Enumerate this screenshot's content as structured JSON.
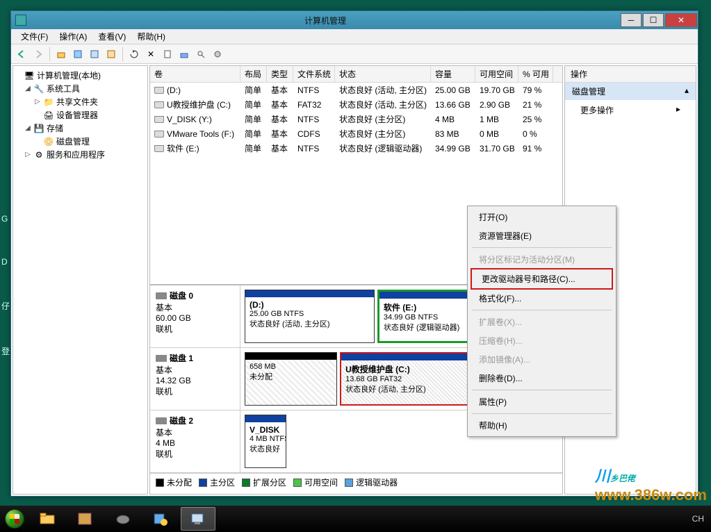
{
  "titlebar": {
    "title": "计算机管理"
  },
  "menubar": {
    "file": "文件(F)",
    "action": "操作(A)",
    "view": "查看(V)",
    "help": "帮助(H)"
  },
  "tree": {
    "root": "计算机管理(本地)",
    "sys_tools": "系统工具",
    "shared_folders": "共享文件夹",
    "device_mgr": "设备管理器",
    "storage": "存储",
    "disk_mgmt": "磁盘管理",
    "services": "服务和应用程序"
  },
  "columns": {
    "vol": "卷",
    "layout": "布局",
    "type": "类型",
    "fs": "文件系统",
    "status": "状态",
    "cap": "容量",
    "free": "可用空间",
    "pct": "% 可用"
  },
  "volumes": [
    {
      "name": "(D:)",
      "layout": "简单",
      "type": "基本",
      "fs": "NTFS",
      "status": "状态良好 (活动, 主分区)",
      "cap": "25.00 GB",
      "free": "19.70 GB",
      "pct": "79 %"
    },
    {
      "name": "U教授维护盘 (C:)",
      "layout": "简单",
      "type": "基本",
      "fs": "FAT32",
      "status": "状态良好 (活动, 主分区)",
      "cap": "13.66 GB",
      "free": "2.90 GB",
      "pct": "21 %"
    },
    {
      "name": "V_DISK (Y:)",
      "layout": "简单",
      "type": "基本",
      "fs": "NTFS",
      "status": "状态良好 (主分区)",
      "cap": "4 MB",
      "free": "1 MB",
      "pct": "25 %"
    },
    {
      "name": "VMware Tools (F:)",
      "layout": "简单",
      "type": "基本",
      "fs": "CDFS",
      "status": "状态良好 (主分区)",
      "cap": "83 MB",
      "free": "0 MB",
      "pct": "0 %"
    },
    {
      "name": "软件 (E:)",
      "layout": "简单",
      "type": "基本",
      "fs": "NTFS",
      "status": "状态良好 (逻辑驱动器)",
      "cap": "34.99 GB",
      "free": "31.70 GB",
      "pct": "91 %"
    }
  ],
  "disks": [
    {
      "name": "磁盘 0",
      "type": "基本",
      "size": "60.00 GB",
      "state": "联机",
      "parts": [
        {
          "label": "(D:)",
          "meta1": "25.00 GB NTFS",
          "meta2": "状态良好 (活动, 主分区)",
          "flex": 25,
          "cls": "part-primary"
        },
        {
          "label": "软件  (E:)",
          "meta1": "34.99 GB NTFS",
          "meta2": "状态良好 (逻辑驱动器)",
          "flex": 35,
          "cls": "part-primary part-green"
        }
      ]
    },
    {
      "name": "磁盘 1",
      "type": "基本",
      "size": "14.32 GB",
      "state": "联机",
      "parts": [
        {
          "label": "",
          "meta1": "658 MB",
          "meta2": "未分配",
          "flex": 12,
          "cls": "part-unalloc"
        },
        {
          "label": "U教授维护盘   (C:)",
          "meta1": "13.68 GB FAT32",
          "meta2": "状态良好 (活动, 主分区)",
          "flex": 30,
          "cls": "part-primary part-selected"
        }
      ]
    },
    {
      "name": "磁盘 2",
      "type": "基本",
      "size": "4 MB",
      "state": "联机",
      "parts": [
        {
          "label": "V_DISK",
          "meta1": "4 MB NTFS",
          "meta2": "状态良好",
          "flex": 6,
          "cls": "part-primary",
          "narrow": true
        }
      ]
    }
  ],
  "legend": {
    "unalloc": "未分配",
    "primary": "主分区",
    "extended": "扩展分区",
    "free": "可用空间",
    "logical": "逻辑驱动器"
  },
  "actions": {
    "header": "操作",
    "disk_mgmt": "磁盘管理",
    "more": "更多操作"
  },
  "context_menu": [
    {
      "label": "打开(O)",
      "enabled": true
    },
    {
      "label": "资源管理器(E)",
      "enabled": true
    },
    {
      "sep": true
    },
    {
      "label": "将分区标记为活动分区(M)",
      "enabled": false
    },
    {
      "label": "更改驱动器号和路径(C)...",
      "enabled": true,
      "highlight": true
    },
    {
      "label": "格式化(F)...",
      "enabled": true
    },
    {
      "sep": true
    },
    {
      "label": "扩展卷(X)...",
      "enabled": false
    },
    {
      "label": "压缩卷(H)...",
      "enabled": false
    },
    {
      "label": "添加镜像(A)...",
      "enabled": false
    },
    {
      "label": "删除卷(D)...",
      "enabled": true
    },
    {
      "sep": true
    },
    {
      "label": "属性(P)",
      "enabled": true
    },
    {
      "sep": true
    },
    {
      "label": "帮助(H)",
      "enabled": true
    }
  ],
  "tray": {
    "ime": "CH"
  },
  "watermark": {
    "a": "川",
    "b": "乡巴佬",
    "sub": "www.386w.com"
  },
  "side_hints": [
    "G",
    "D",
    "仔",
    "登"
  ]
}
